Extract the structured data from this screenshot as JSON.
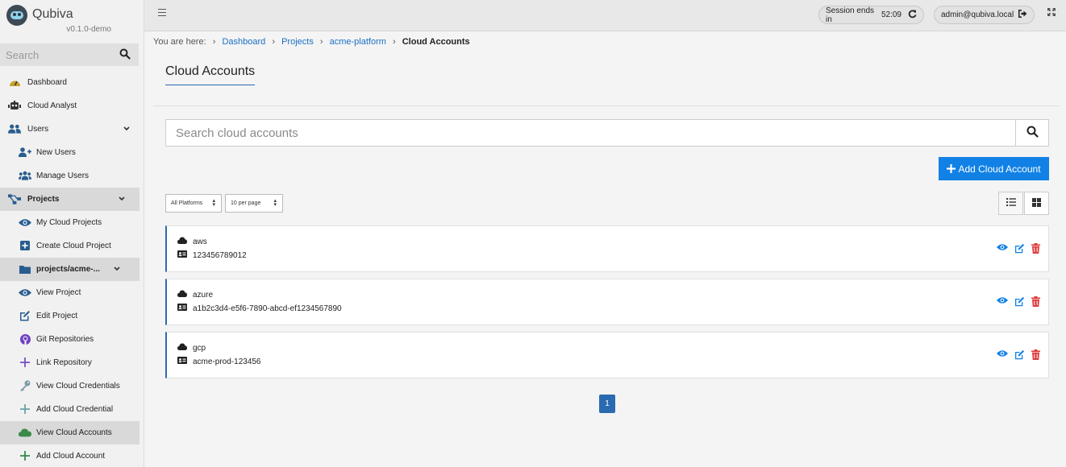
{
  "app": {
    "name": "Qubiva",
    "version": "v0.1.0-demo"
  },
  "sidebar": {
    "search_placeholder": "Search",
    "items": [
      {
        "label": "Dashboard",
        "icon": "dashboard-gauge-icon"
      },
      {
        "label": "Cloud Analyst",
        "icon": "robot-icon"
      },
      {
        "label": "Users",
        "icon": "users-icon",
        "chevron": "⌄"
      },
      {
        "label": "New Users",
        "icon": "user-plus-icon"
      },
      {
        "label": "Manage Users",
        "icon": "users-cog-icon"
      },
      {
        "label": "Projects",
        "icon": "project-diagram-icon",
        "chevron": "⌄"
      },
      {
        "label": "My Cloud Projects",
        "icon": "eye-icon"
      },
      {
        "label": "Create Cloud Project",
        "icon": "plus-square-icon"
      },
      {
        "label": "projects/acme-...",
        "icon": "folder-icon",
        "chevron": "⌄"
      },
      {
        "label": "View Project",
        "icon": "eye-icon"
      },
      {
        "label": "Edit Project",
        "icon": "edit-icon"
      },
      {
        "label": "Git Repositories",
        "icon": "github-icon"
      },
      {
        "label": "Link Repository",
        "icon": "plus-icon"
      },
      {
        "label": "View Cloud Credentials",
        "icon": "key-icon"
      },
      {
        "label": "Add Cloud Credential",
        "icon": "plus-icon"
      },
      {
        "label": "View Cloud Accounts",
        "icon": "cloud-icon"
      },
      {
        "label": "Add Cloud Account",
        "icon": "plus-icon"
      }
    ]
  },
  "topbar": {
    "session_label": "Session ends in",
    "session_time": "52:09",
    "user": "admin@qubiva.local"
  },
  "breadcrumb": {
    "prefix": "You are here:",
    "links": [
      "Dashboard",
      "Projects",
      "acme-platform"
    ],
    "current": "Cloud Accounts"
  },
  "page": {
    "title": "Cloud Accounts",
    "search_placeholder": "Search cloud accounts",
    "add_button": "Add Cloud Account",
    "platform_filter": "All Platforms",
    "per_page": "10 per page"
  },
  "accounts": [
    {
      "platform": "aws",
      "id": "123456789012"
    },
    {
      "platform": "azure",
      "id": "a1b2c3d4-e5f6-7890-abcd-ef1234567890"
    },
    {
      "platform": "gcp",
      "id": "acme-prod-123456"
    }
  ],
  "pagination": {
    "current": "1"
  },
  "colors": {
    "primary": "#1181e6",
    "accent": "#2a6ab1",
    "danger": "#e03a3a"
  }
}
